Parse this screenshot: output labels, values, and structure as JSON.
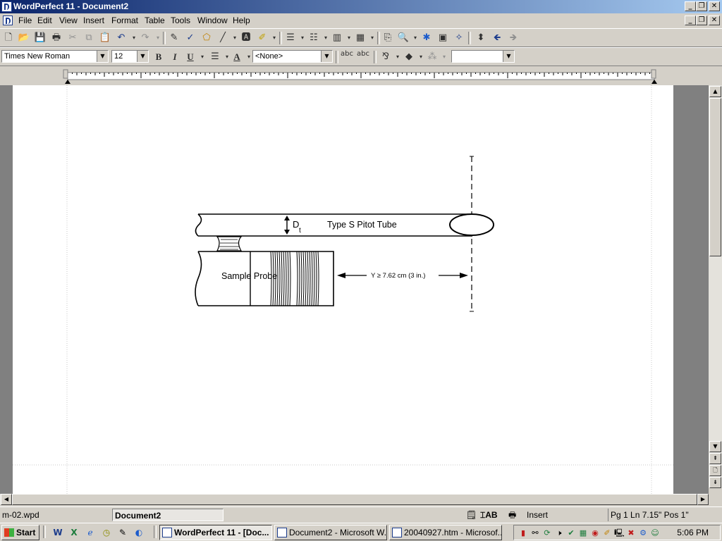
{
  "window": {
    "title": "WordPerfect 11 - Document2",
    "controls": {
      "minimize": "_",
      "restore": "❐",
      "close": "✕"
    }
  },
  "menu": {
    "items": [
      "File",
      "Edit",
      "View",
      "Insert",
      "Format",
      "Table",
      "Tools",
      "Window",
      "Help"
    ]
  },
  "property_bar": {
    "font_face": "Times New Roman",
    "font_size": "12",
    "bold_label": "B",
    "italic_label": "I",
    "underline_label": "U",
    "style": "<None>",
    "abc_label": "abc",
    "extra_combo": ""
  },
  "document": {
    "diagram": {
      "dt_label": "D",
      "dt_subscript": "t",
      "pitot_label": "Type S Pitot Tube",
      "probe_label": "Sample Probe",
      "distance_label": "Y ≥ 7.62 cm (3 in.)"
    }
  },
  "status": {
    "filename": "m-02.wpd",
    "document": "Document2",
    "ab_label": "AB",
    "mode": "Insert",
    "position": "Pg 1 Ln 7.15\" Pos 1\""
  },
  "taskbar": {
    "start": "Start",
    "tasks": [
      {
        "label": "WordPerfect 11 - [Doc...",
        "active": true
      },
      {
        "label": "Document2 - Microsoft W...",
        "active": false
      },
      {
        "label": "20040927.htm - Microsof...",
        "active": false
      }
    ],
    "clock": "5:06 PM"
  }
}
